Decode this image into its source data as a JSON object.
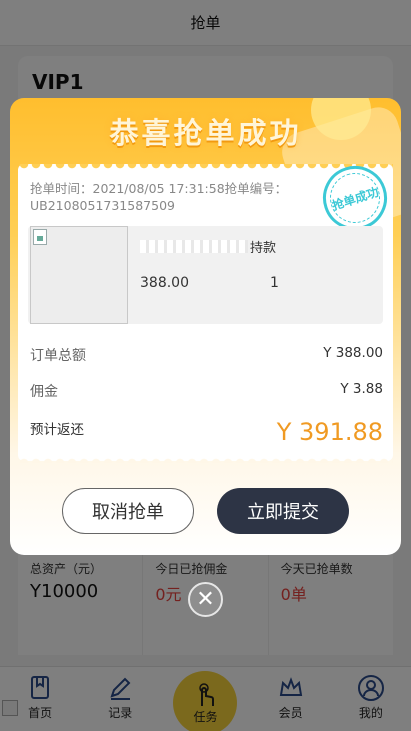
{
  "header": {
    "title": "抢单"
  },
  "vip": {
    "level": "VIP1"
  },
  "stats": [
    {
      "label": "总资产（元）",
      "value": "Y10000"
    },
    {
      "label": "今日已抢佣金",
      "value": "0元"
    },
    {
      "label": "今天已抢单数",
      "value": "0单"
    }
  ],
  "nav": {
    "home": "首页",
    "records": "记录",
    "task": "任务",
    "member": "会员",
    "mine": "我的"
  },
  "modal": {
    "title": "恭喜抢单成功",
    "order_meta": "抢单时间：2021/08/05 17:31:58抢单编号：UB2108051731587509",
    "stamp": "抢单成功",
    "product": {
      "name_suffix": "持款",
      "price": "388.00",
      "qty": "1"
    },
    "total_label": "订单总额",
    "total_value": "Y 388.00",
    "commission_label": "佣金",
    "commission_value": "Y 3.88",
    "estimate_label": "预计返还",
    "estimate_value": "Y 391.88",
    "cancel_label": "取消抢单",
    "submit_label": "立即提交",
    "close_glyph": "✕"
  },
  "colors": {
    "accent_orange": "#f09a23",
    "submit_dark": "#2d3445",
    "stamp_teal": "#3cc9d6",
    "modal_yellow": "#ffbe2e"
  }
}
